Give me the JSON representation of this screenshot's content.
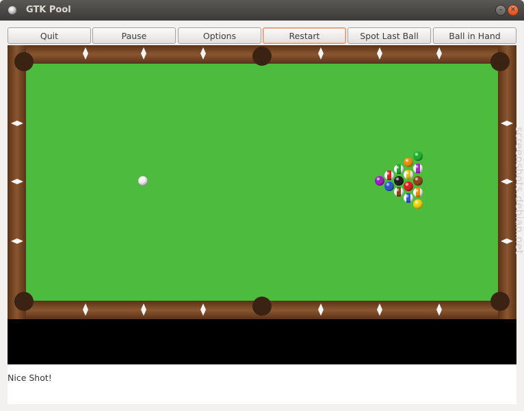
{
  "window": {
    "title": "GTK Pool"
  },
  "toolbar": {
    "buttons": [
      {
        "label": "Quit"
      },
      {
        "label": "Pause"
      },
      {
        "label": "Options"
      },
      {
        "label": "Restart",
        "focused": true
      },
      {
        "label": "Spot Last Ball"
      },
      {
        "label": "Ball in Hand"
      }
    ]
  },
  "status": {
    "message": "Nice Shot!"
  },
  "watermark": {
    "text": "screenshots.debian.net"
  },
  "colors": {
    "felt": "#4cbb3e",
    "rail": "#7a4824",
    "pocket": "#3a2313",
    "focus_border": "#ee8a62"
  },
  "balls": [
    {
      "name": "cue-ball",
      "color": "#f2f2f2",
      "stripe": false
    },
    {
      "name": "ball-1",
      "color": "#f2d300",
      "stripe": false
    },
    {
      "name": "ball-2",
      "color": "#1f4fcf",
      "stripe": false
    },
    {
      "name": "ball-3",
      "color": "#e01010",
      "stripe": false
    },
    {
      "name": "ball-4",
      "color": "#9a10c0",
      "stripe": false
    },
    {
      "name": "ball-5",
      "color": "#e88a00",
      "stripe": false
    },
    {
      "name": "ball-6",
      "color": "#10b020",
      "stripe": false
    },
    {
      "name": "ball-7",
      "color": "#8a3a08",
      "stripe": false
    },
    {
      "name": "ball-8",
      "color": "#111111",
      "stripe": false
    },
    {
      "name": "ball-9",
      "color": "#e0c000",
      "stripe": true
    },
    {
      "name": "ball-10",
      "color": "#2050d0",
      "stripe": true
    },
    {
      "name": "ball-11",
      "color": "#d01818",
      "stripe": true
    },
    {
      "name": "ball-12",
      "color": "#9a20c0",
      "stripe": true
    },
    {
      "name": "ball-13",
      "color": "#e88a00",
      "stripe": true
    },
    {
      "name": "ball-14",
      "color": "#10a020",
      "stripe": true
    },
    {
      "name": "ball-15",
      "color": "#8a3a08",
      "stripe": true
    }
  ]
}
